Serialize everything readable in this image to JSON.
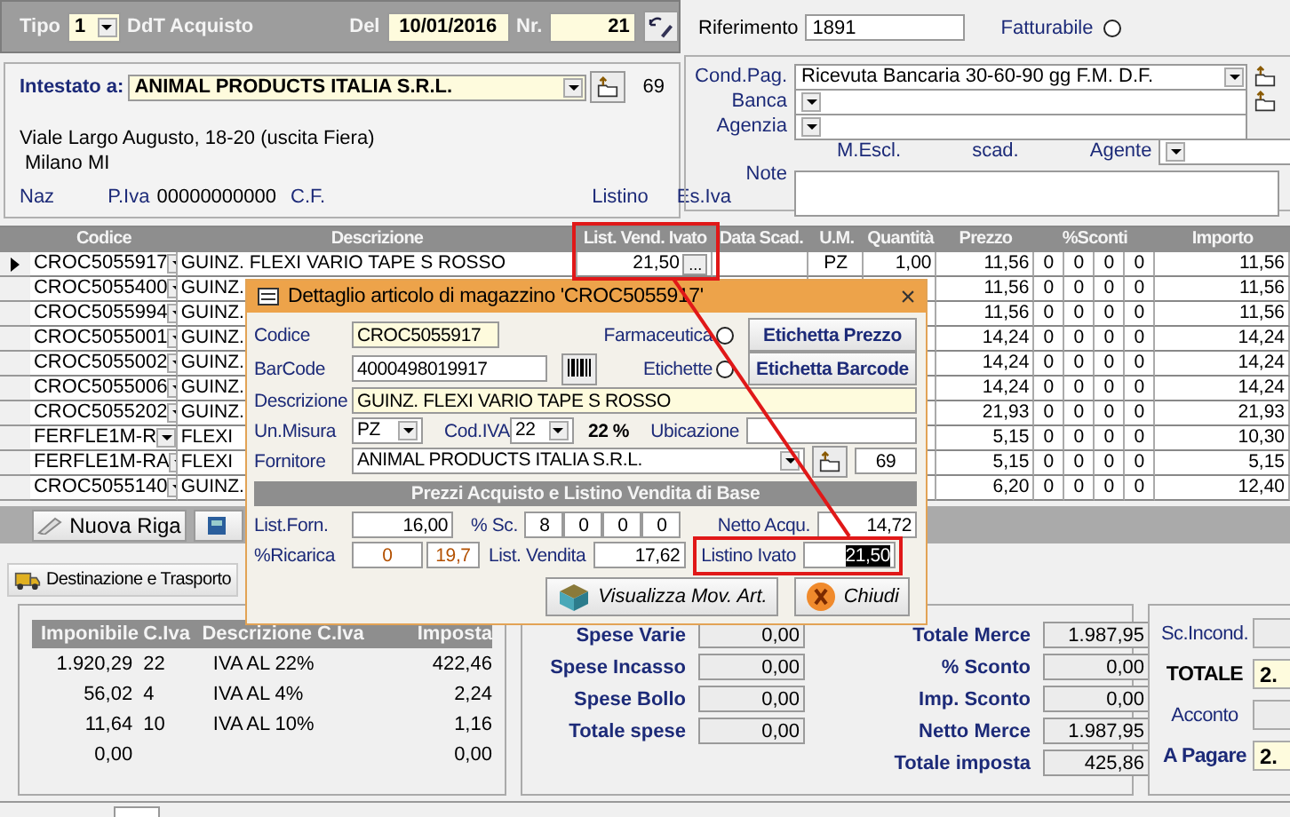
{
  "header": {
    "tipo_label": "Tipo",
    "tipo": "1",
    "doc_type": "DdT Acquisto",
    "del_label": "Del",
    "date": "10/01/2016",
    "nr_label": "Nr.",
    "number": "21",
    "riferimento_label": "Riferimento",
    "riferimento": "1891",
    "fatturabile_label": "Fatturabile",
    "fatturabile": false
  },
  "customer": {
    "label": "Intestato a:",
    "name": "ANIMAL PRODUCTS ITALIA S.R.L.",
    "code": "69",
    "address": "Viale Largo Augusto, 18-20 (uscita Fiera)",
    "city": "Milano  MI",
    "naz_label": "Naz",
    "piva_label": "P.Iva",
    "piva": "00000000000",
    "cf_label": "C.F.",
    "listino_label": "Listino",
    "esiva_label": "Es.Iva"
  },
  "payment": {
    "fields": [
      {
        "label": "Cond.Pag.",
        "value": "Ricevuta Bancaria 30-60-90 gg F.M. D.F.",
        "kind": "select-add"
      },
      {
        "label": "Banca",
        "kind": "select-add"
      },
      {
        "label": "Agenzia",
        "kind": "select"
      }
    ],
    "mescl_label": "M.Escl.",
    "scad_label": "scad.",
    "agente_label": "Agente",
    "note_label": "Note"
  },
  "table": {
    "columns": [
      "Codice",
      "Descrizione",
      "List. Vend. Ivato",
      "Data Scad.",
      "U.M.",
      "Quantità",
      "Prezzo",
      "%Sconti",
      "Importo"
    ],
    "rows": [
      {
        "selected": true,
        "codice": "CROC5055917",
        "descrizione": "GUINZ. FLEXI VARIO TAPE S ROSSO",
        "list_vend": "21,50",
        "list_vend_button": "...",
        "um": "PZ",
        "quantita": "1,00",
        "prezzo": "11,56",
        "sconti": [
          "0",
          "0",
          "0",
          "0"
        ],
        "importo": "11,56"
      },
      {
        "selected": false,
        "codice": "CROC5055400",
        "descrizione": "GUINZ.",
        "prezzo": "11,56",
        "sconti": [
          "0",
          "0",
          "0",
          "0"
        ],
        "importo": "11,56"
      },
      {
        "selected": false,
        "codice": "CROC5055994",
        "descrizione": "GUINZ.",
        "prezzo": "11,56",
        "sconti": [
          "0",
          "0",
          "0",
          "0"
        ],
        "importo": "11,56"
      },
      {
        "selected": false,
        "codice": "CROC5055001",
        "descrizione": "GUINZ.",
        "prezzo": "14,24",
        "sconti": [
          "0",
          "0",
          "0",
          "0"
        ],
        "importo": "14,24"
      },
      {
        "selected": false,
        "codice": "CROC5055002",
        "descrizione": "GUINZ.",
        "prezzo": "14,24",
        "sconti": [
          "0",
          "0",
          "0",
          "0"
        ],
        "importo": "14,24"
      },
      {
        "selected": false,
        "codice": "CROC5055006",
        "descrizione": "GUINZ.",
        "prezzo": "14,24",
        "sconti": [
          "0",
          "0",
          "0",
          "0"
        ],
        "importo": "14,24"
      },
      {
        "selected": false,
        "codice": "CROC5055202",
        "descrizione": "GUINZ.",
        "prezzo": "21,93",
        "sconti": [
          "0",
          "0",
          "0",
          "0"
        ],
        "importo": "21,93"
      },
      {
        "selected": false,
        "codice": "FERFLE1M-R",
        "descrizione": "FLEXI",
        "prezzo": "5,15",
        "sconti": [
          "0",
          "0",
          "0",
          "0"
        ],
        "importo": "10,30"
      },
      {
        "selected": false,
        "codice": "FERFLE1M-RA",
        "descrizione": "FLEXI",
        "prezzo": "5,15",
        "sconti": [
          "0",
          "0",
          "0",
          "0"
        ],
        "importo": "5,15"
      },
      {
        "selected": false,
        "codice": "CROC5055140",
        "descrizione": "GUINZ.",
        "prezzo": "6,20",
        "sconti": [
          "0",
          "0",
          "0",
          "0"
        ],
        "importo": "12,40"
      }
    ]
  },
  "new_row_button": "Nuova Riga",
  "destination_button": "Destinazione e Trasporto",
  "vat": {
    "columns": [
      "Imponibile",
      "C.Iva",
      "Descrizione C.Iva",
      "Imposta"
    ],
    "rows": [
      {
        "imponibile": "1.920,29",
        "codice": "22",
        "descrizione": "IVA AL 22%",
        "imposta": "422,46"
      },
      {
        "imponibile": "56,02",
        "codice": "4",
        "descrizione": "IVA AL 4%",
        "imposta": "2,24"
      },
      {
        "imponibile": "11,64",
        "codice": "10",
        "descrizione": "IVA AL 10%",
        "imposta": "1,16"
      },
      {
        "imponibile": "0,00",
        "imposta": "0,00"
      }
    ]
  },
  "expenses": [
    {
      "label": "Spese Varie",
      "value": "0,00"
    },
    {
      "label": "Spese Incasso",
      "value": "0,00"
    },
    {
      "label": "Spese Bollo",
      "value": "0,00"
    },
    {
      "label": "Totale spese",
      "value": "0,00"
    }
  ],
  "totals": [
    {
      "label": "Totale Merce",
      "value": "1.987,95"
    },
    {
      "label": "% Sconto",
      "value": "0,00"
    },
    {
      "label": "Imp. Sconto",
      "value": "0,00"
    },
    {
      "label": "Netto Merce",
      "value": "1.987,95"
    },
    {
      "label": "Totale imposta",
      "value": "425,86"
    }
  ],
  "grand": [
    {
      "label": "Sc.Incond.",
      "kind": "plain"
    },
    {
      "label": "TOTALE",
      "value": "2.",
      "kind": "strong"
    },
    {
      "label": "Acconto",
      "kind": "plain"
    },
    {
      "label": "A Pagare",
      "value": "2.",
      "kind": "strong"
    }
  ],
  "dialog": {
    "title": "Dettaglio articolo di magazzino 'CROC5055917'",
    "close": "×",
    "codice_label": "Codice",
    "codice": "CROC5055917",
    "farmaceutica_label": "Farmaceutica",
    "farmaceutica": false,
    "etichetta_prezzo": "Etichetta Prezzo",
    "barcode_label": "BarCode",
    "barcode": "4000498019917",
    "etichette_label": "Etichette",
    "etichette": false,
    "etichetta_barcode": "Etichetta Barcode",
    "descrizione_label": "Descrizione",
    "descrizione": "GUINZ. FLEXI VARIO TAPE S ROSSO",
    "um_label": "Un.Misura",
    "um": "PZ",
    "codiva_label": "Cod.IVA",
    "codiva": "22",
    "iva_pct": "22 %",
    "ubicazione_label": "Ubicazione",
    "fornitore_label": "Fornitore",
    "fornitore": "ANIMAL PRODUCTS ITALIA S.R.L.",
    "fornitore_code": "69",
    "section": "Prezzi Acquisto e Listino Vendita di Base",
    "listforn_label": "List.Forn.",
    "listforn": "16,00",
    "sc_label": "% Sc.",
    "sconti": [
      "8",
      "0",
      "0",
      "0"
    ],
    "netto_label": "Netto Acqu.",
    "netto": "14,72",
    "ricarica_label": "%Ricarica",
    "ricarica": [
      "0",
      "19,7"
    ],
    "listvendita_label": "List. Vendita",
    "listvendita": "17,62",
    "listivato_label": "Listino Ivato",
    "listivato": "21,50",
    "listivato_selected": true,
    "buttons": [
      {
        "label": "Visualizza Mov. Art.",
        "kind": "movements"
      },
      {
        "label": "Chiudi",
        "kind": "close"
      }
    ]
  }
}
